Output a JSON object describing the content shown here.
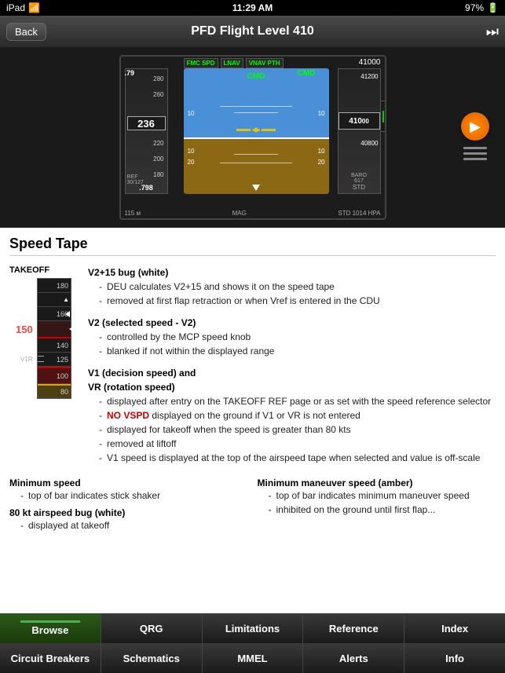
{
  "statusBar": {
    "left": "iPad",
    "wifi": "wifi",
    "time": "11:29 AM",
    "battery": "97%"
  },
  "navBar": {
    "backLabel": "Back",
    "title": "PFD Flight Level 410",
    "rightIcon": "⏭"
  },
  "pfd": {
    "speedValue": "236",
    "altValue": "41000",
    "altValue2": "410",
    "mach": ".79",
    "machBottom": ".798",
    "altitude1": "41000",
    "altitude2": "41200",
    "altitude3": "40800",
    "alt_box": "41000",
    "baro": "BARO 617",
    "std": "STD",
    "hpa": "1014 HPA",
    "hdg": "115 м",
    "mag": "MAG",
    "modes": [
      "FMC SPD",
      "LNAV",
      "VNAV PTH"
    ],
    "cmd": "CMD",
    "speedTicks": [
      "280",
      "260",
      "220",
      "200",
      "180"
    ],
    "ref": "REF 30/127"
  },
  "section": {
    "title": "Speed Tape"
  },
  "speedDiagram": {
    "takeoffLabel": "TAKEOFF",
    "speeds": [
      {
        "value": "180",
        "color": "white"
      },
      {
        "value": "160",
        "color": "white"
      },
      {
        "value": "150",
        "color": "red",
        "isMain": true
      },
      {
        "value": "140",
        "color": "white"
      },
      {
        "value": "125",
        "color": "white",
        "hasBox": true
      },
      {
        "value": "100",
        "color": "white"
      },
      {
        "value": "80",
        "color": "white"
      }
    ],
    "markerV1R": "V1R"
  },
  "descriptions": [
    {
      "title": "V2+15 bug (white)",
      "bullets": [
        "DEU calculates V2+15 and shows it on the speed tape",
        "removed at first flap retraction or when Vref is entered in the CDU"
      ]
    },
    {
      "title": "V2 (selected speed - V2)",
      "bullets": [
        "controlled by the MCP speed knob",
        "blanked if not within the displayed range"
      ]
    },
    {
      "title": "V1 (decision speed) and",
      "title2": "VR (rotation speed)",
      "bullets": [
        "displayed after entry on the TAKEOFF REF page or as set with the speed reference selector",
        "NO VSPD displayed on the ground if V1 or VR is not entered",
        "displayed for takeoff when the speed is greater than 80 kts",
        "removed at liftoff",
        "V1 speed is displayed at the top of the airspeed tape when selected and value is off-scale"
      ],
      "redBullet": 1
    }
  ],
  "bottomDescriptions": {
    "left": {
      "title": "Minimum speed",
      "bullets": [
        "top of bar indicates stick shaker"
      ]
    },
    "right": {
      "title": "Minimum maneuver speed (amber)",
      "bullets": [
        "top of bar indicates minimum maneuver speed"
      ]
    }
  },
  "bottomDesc2": {
    "title": "80 kt airspeed bug (white)",
    "bullet": "displayed at takeoff"
  },
  "tabBar1": {
    "tabs": [
      "Browse",
      "QRG",
      "Limitations",
      "Reference",
      "Index"
    ]
  },
  "tabBar2": {
    "tabs": [
      "Circuit Breakers",
      "Schematics",
      "MMEL",
      "Alerts",
      "Info"
    ]
  }
}
